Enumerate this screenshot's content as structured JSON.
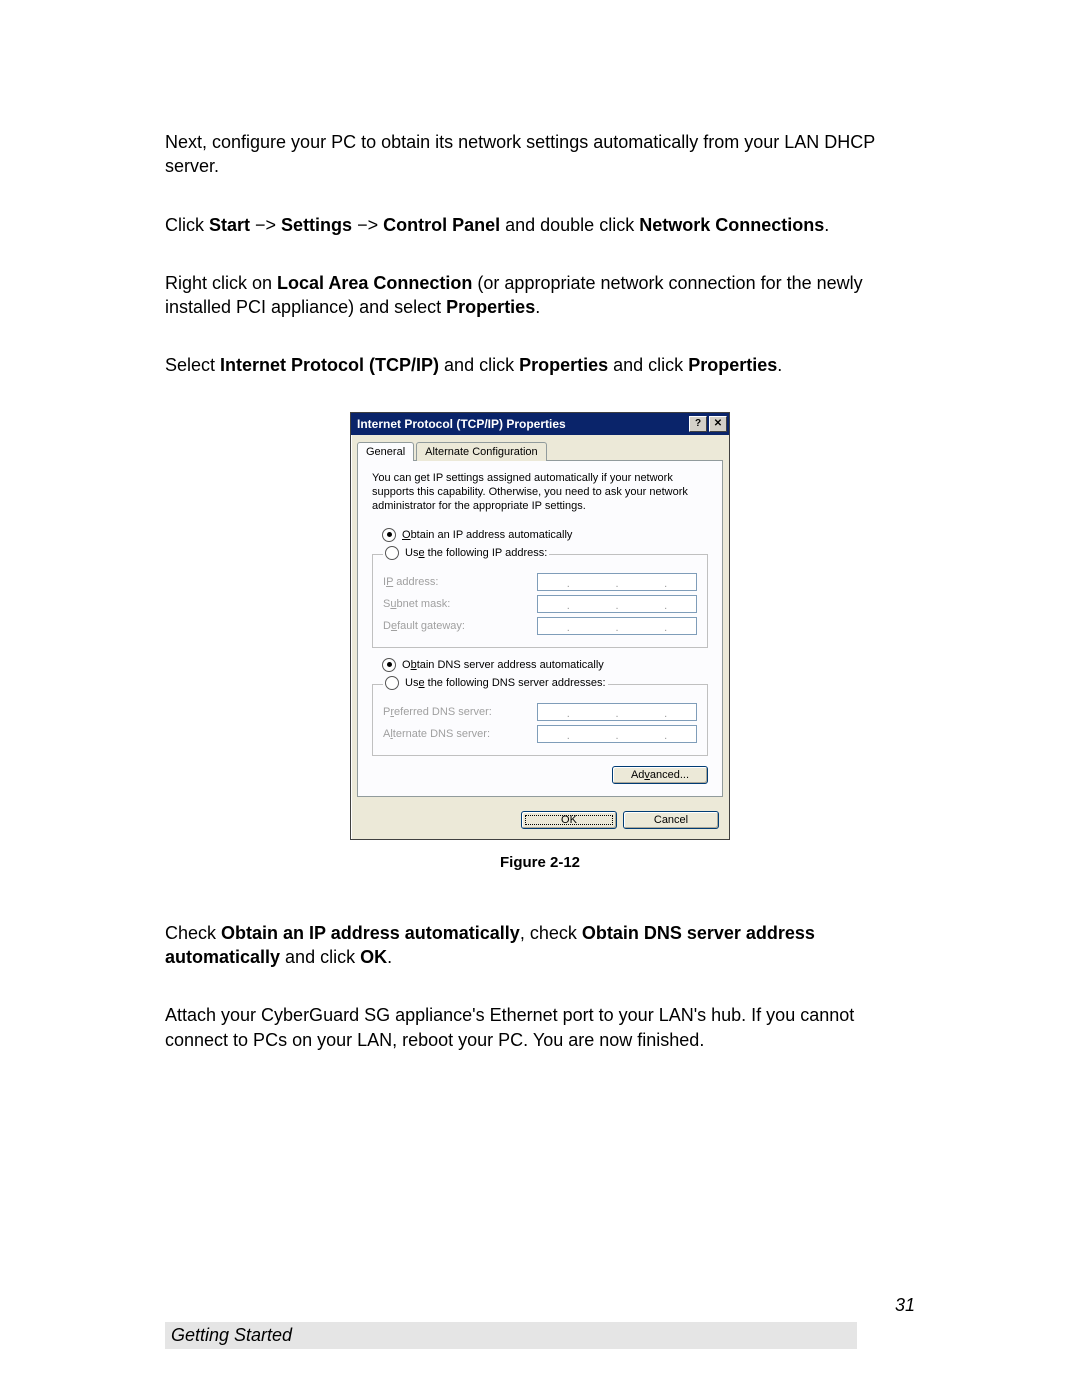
{
  "paragraph1": "Next, configure your PC to obtain its network settings automatically from your LAN DHCP server.",
  "p2": {
    "a": "Click ",
    "b": "Start",
    "c": " −> ",
    "d": "Settings",
    "e": " −> ",
    "f": "Control Panel",
    "g": " and double click ",
    "h": "Network Connections",
    "i": "."
  },
  "p3": {
    "a": "Right click on ",
    "b": "Local Area Connection",
    "c": " (or appropriate network connection for the newly installed PCI appliance) and select ",
    "d": "Properties",
    "e": "."
  },
  "p4": {
    "a": "Select ",
    "b": "Internet Protocol (TCP/IP)",
    "c": " and click ",
    "d": "Properties",
    "e": " and click ",
    "f": "Properties",
    "g": "."
  },
  "dialog": {
    "title": "Internet Protocol (TCP/IP) Properties",
    "tabs": {
      "general": "General",
      "alt": "Alternate Configuration"
    },
    "intro": "You can get IP settings assigned automatically if your network supports this capability. Otherwise, you need to ask your network administrator for the appropriate IP settings.",
    "ip_auto_pre": "O",
    "ip_auto": "btain an IP address automatically",
    "ip_manual_pre": "Us",
    "ip_manual_key": "e",
    "ip_manual_post": " the following IP address:",
    "fld_ip_pre": "I",
    "fld_ip_key": "P",
    "fld_ip_post": " address:",
    "fld_sub_pre": "S",
    "fld_sub_key": "u",
    "fld_sub_post": "bnet mask:",
    "fld_gw_pre": "D",
    "fld_gw_key": "e",
    "fld_gw_post": "fault gateway:",
    "dns_auto_pre": "O",
    "dns_auto_key": "b",
    "dns_auto_post": "tain DNS server address automatically",
    "dns_manual_pre": "Us",
    "dns_manual_key": "e",
    "dns_manual_post": " the following DNS server addresses:",
    "fld_pdns_pre": "P",
    "fld_pdns_key": "r",
    "fld_pdns_post": "eferred DNS server:",
    "fld_adns_pre": "A",
    "fld_adns_key": "l",
    "fld_adns_post": "ternate DNS server:",
    "advanced_pre": "Ad",
    "advanced_key": "v",
    "advanced_post": "anced...",
    "ok": "OK",
    "cancel": "Cancel"
  },
  "figure_caption": "Figure 2-12",
  "p5": {
    "a": "Check ",
    "b": "Obtain an IP address automatically",
    "c": ", check ",
    "d": "Obtain DNS server address automatically",
    "e": " and click ",
    "f": "OK",
    "g": "."
  },
  "paragraph6": "Attach your CyberGuard SG appliance's Ethernet port to your LAN's hub.  If you cannot connect to PCs on your LAN, reboot your PC.  You are now finished.",
  "page_number": "31",
  "footer_text": "Getting Started"
}
